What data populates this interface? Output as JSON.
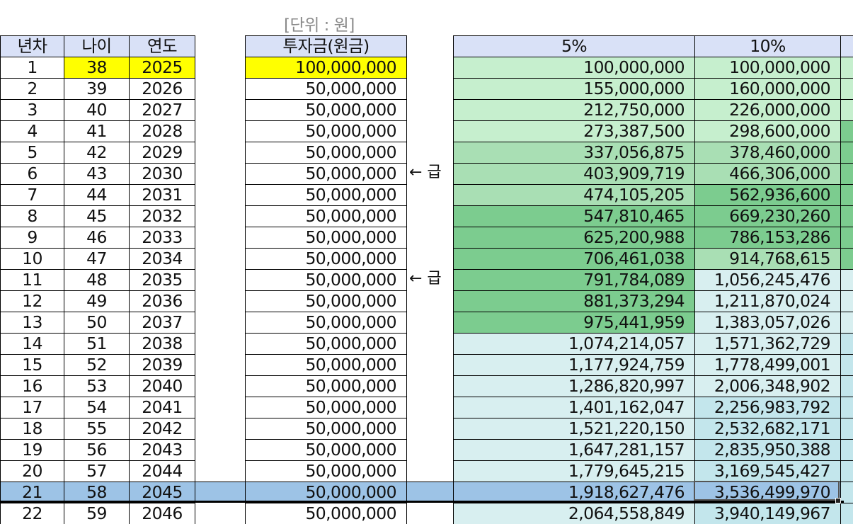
{
  "unit_label": "[단위 : 원]",
  "headers": {
    "year_no": "년차",
    "age": "나이",
    "year": "연도",
    "principal": "투자금(원금)",
    "rate1": "5%",
    "rate2": "10%"
  },
  "notes": [
    "← 급",
    "← 급"
  ],
  "colors": {
    "header": "#d9e1f7",
    "yellow": "#ffff00",
    "selected_row": "#9dc3e6",
    "green_light": "#c6efce",
    "green_mid": "#a9dfb4",
    "green_dark": "#7ccc8f",
    "teal_light": "#d8eff0",
    "teal_mid": "#c3e6ec"
  },
  "rows": [
    {
      "n": "1",
      "age": "38",
      "year": "2025",
      "principal": "100,000,000",
      "v5": "100,000,000",
      "v10": "100,000,000"
    },
    {
      "n": "2",
      "age": "39",
      "year": "2026",
      "principal": "50,000,000",
      "v5": "155,000,000",
      "v10": "160,000,000"
    },
    {
      "n": "3",
      "age": "40",
      "year": "2027",
      "principal": "50,000,000",
      "v5": "212,750,000",
      "v10": "226,000,000"
    },
    {
      "n": "4",
      "age": "41",
      "year": "2028",
      "principal": "50,000,000",
      "v5": "273,387,500",
      "v10": "298,600,000"
    },
    {
      "n": "5",
      "age": "42",
      "year": "2029",
      "principal": "50,000,000",
      "v5": "337,056,875",
      "v10": "378,460,000"
    },
    {
      "n": "6",
      "age": "43",
      "year": "2030",
      "principal": "50,000,000",
      "v5": "403,909,719",
      "v10": "466,306,000"
    },
    {
      "n": "7",
      "age": "44",
      "year": "2031",
      "principal": "50,000,000",
      "v5": "474,105,205",
      "v10": "562,936,600"
    },
    {
      "n": "8",
      "age": "45",
      "year": "2032",
      "principal": "50,000,000",
      "v5": "547,810,465",
      "v10": "669,230,260"
    },
    {
      "n": "9",
      "age": "46",
      "year": "2033",
      "principal": "50,000,000",
      "v5": "625,200,988",
      "v10": "786,153,286"
    },
    {
      "n": "10",
      "age": "47",
      "year": "2034",
      "principal": "50,000,000",
      "v5": "706,461,038",
      "v10": "914,768,615"
    },
    {
      "n": "11",
      "age": "48",
      "year": "2035",
      "principal": "50,000,000",
      "v5": "791,784,089",
      "v10": "1,056,245,476"
    },
    {
      "n": "12",
      "age": "49",
      "year": "2036",
      "principal": "50,000,000",
      "v5": "881,373,294",
      "v10": "1,211,870,024"
    },
    {
      "n": "13",
      "age": "50",
      "year": "2037",
      "principal": "50,000,000",
      "v5": "975,441,959",
      "v10": "1,383,057,026"
    },
    {
      "n": "14",
      "age": "51",
      "year": "2038",
      "principal": "50,000,000",
      "v5": "1,074,214,057",
      "v10": "1,571,362,729"
    },
    {
      "n": "15",
      "age": "52",
      "year": "2039",
      "principal": "50,000,000",
      "v5": "1,177,924,759",
      "v10": "1,778,499,001"
    },
    {
      "n": "16",
      "age": "53",
      "year": "2040",
      "principal": "50,000,000",
      "v5": "1,286,820,997",
      "v10": "2,006,348,902"
    },
    {
      "n": "17",
      "age": "54",
      "year": "2041",
      "principal": "50,000,000",
      "v5": "1,401,162,047",
      "v10": "2,256,983,792"
    },
    {
      "n": "18",
      "age": "55",
      "year": "2042",
      "principal": "50,000,000",
      "v5": "1,521,220,150",
      "v10": "2,532,682,171"
    },
    {
      "n": "19",
      "age": "56",
      "year": "2043",
      "principal": "50,000,000",
      "v5": "1,647,281,157",
      "v10": "2,835,950,388"
    },
    {
      "n": "20",
      "age": "57",
      "year": "2044",
      "principal": "50,000,000",
      "v5": "1,779,645,215",
      "v10": "3,169,545,427"
    },
    {
      "n": "21",
      "age": "58",
      "year": "2045",
      "principal": "50,000,000",
      "v5": "1,918,627,476",
      "v10": "3,536,499,970"
    },
    {
      "n": "22",
      "age": "59",
      "year": "2046",
      "principal": "50,000,000",
      "v5": "2,064,558,849",
      "v10": "3,940,149,967"
    }
  ]
}
